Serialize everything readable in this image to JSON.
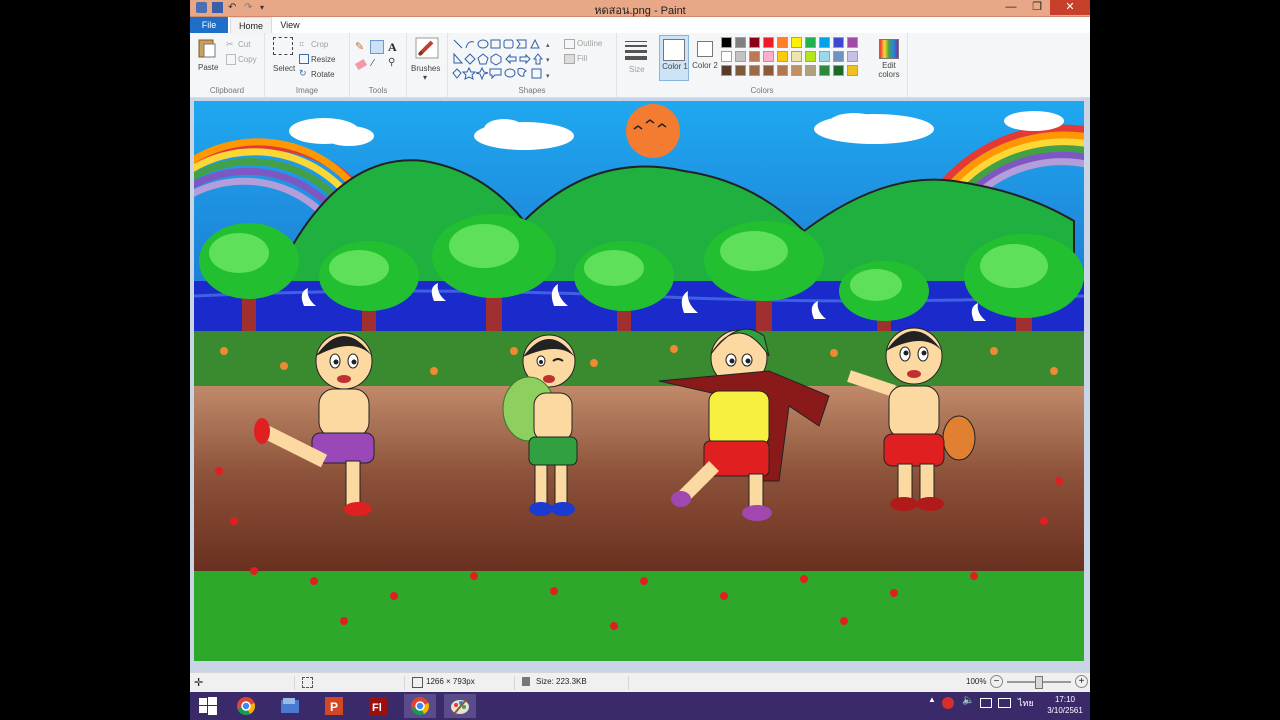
{
  "window": {
    "title": "หดสอน.png - Paint"
  },
  "tabs": {
    "file": "File",
    "home": "Home",
    "view": "View"
  },
  "ribbon": {
    "clipboard": {
      "paste": "Paste",
      "cut": "Cut",
      "copy": "Copy",
      "label": "Clipboard"
    },
    "image": {
      "select": "Select",
      "crop": "Crop",
      "resize": "Resize",
      "rotate": "Rotate",
      "label": "Image"
    },
    "tools": {
      "label": "Tools",
      "text_tool": "A"
    },
    "brushes": {
      "label": "Brushes"
    },
    "shapes": {
      "outline": "Outline",
      "fill": "Fill",
      "label": "Shapes"
    },
    "size": {
      "label": "Size"
    },
    "colors": {
      "color1": "Color 1",
      "color2": "Color 2",
      "edit": "Edit colors",
      "label": "Colors",
      "row1": [
        "#000000",
        "#7f7f7f",
        "#880015",
        "#ed1c24",
        "#ff7f27",
        "#fff200",
        "#22b14c",
        "#00a2e8",
        "#3f48cc",
        "#a349a4"
      ],
      "row2": [
        "#ffffff",
        "#c3c3c3",
        "#b97a57",
        "#ffaec9",
        "#ffc90e",
        "#efe4b0",
        "#b5e61d",
        "#99d9ea",
        "#7092be",
        "#c8bfe7"
      ],
      "row3": [
        "#5a3a2a",
        "#7a5a3a",
        "#9a6a4a",
        "#8a5a3a",
        "#b07850",
        "#c09060",
        "#b0a080",
        "#2a8a3a",
        "#1a6a2a",
        "#f0c020"
      ]
    }
  },
  "status": {
    "dimensions": "1266 × 793px",
    "size": "Size: 223.3KB",
    "zoom": "100%"
  },
  "taskbar": {
    "time": "17:10",
    "date": "3/10/2561",
    "lang": "ไทย"
  }
}
